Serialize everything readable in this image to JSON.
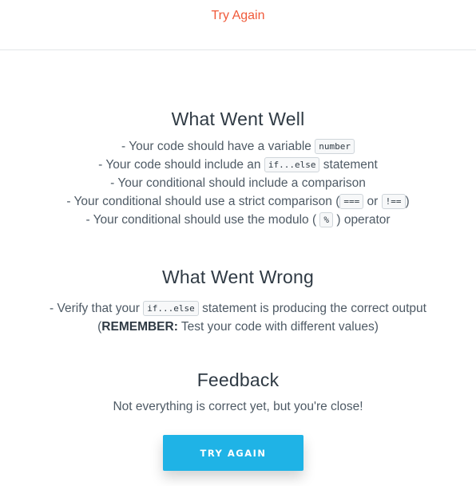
{
  "header": {
    "link_label": "Try Again"
  },
  "went_well": {
    "title": "What Went Well",
    "items": [
      {
        "prefix": "- Your code should have a variable ",
        "code": "number",
        "suffix": ""
      },
      {
        "prefix": "- Your code should include an ",
        "code": "if...else",
        "suffix": " statement"
      },
      {
        "prefix": "- Your conditional should include a comparison",
        "code": "",
        "suffix": ""
      },
      {
        "prefix": "- Your conditional should use a strict comparison (",
        "code": "===",
        "mid": " or ",
        "code2": "!==",
        "suffix": ")"
      },
      {
        "prefix": "- Your conditional should use the modulo ( ",
        "code": "%",
        "suffix": " ) operator"
      }
    ]
  },
  "went_wrong": {
    "title": "What Went Wrong",
    "line1_prefix": "- Verify that your ",
    "line1_code": "if...else",
    "line1_suffix": " statement is producing the correct output",
    "line2_open": "(",
    "line2_bold": "REMEMBER:",
    "line2_rest": " Test your code with different values)"
  },
  "feedback": {
    "title": "Feedback",
    "message": "Not everything is correct yet, but you're close!"
  },
  "button": {
    "label": "TRY AGAIN"
  }
}
